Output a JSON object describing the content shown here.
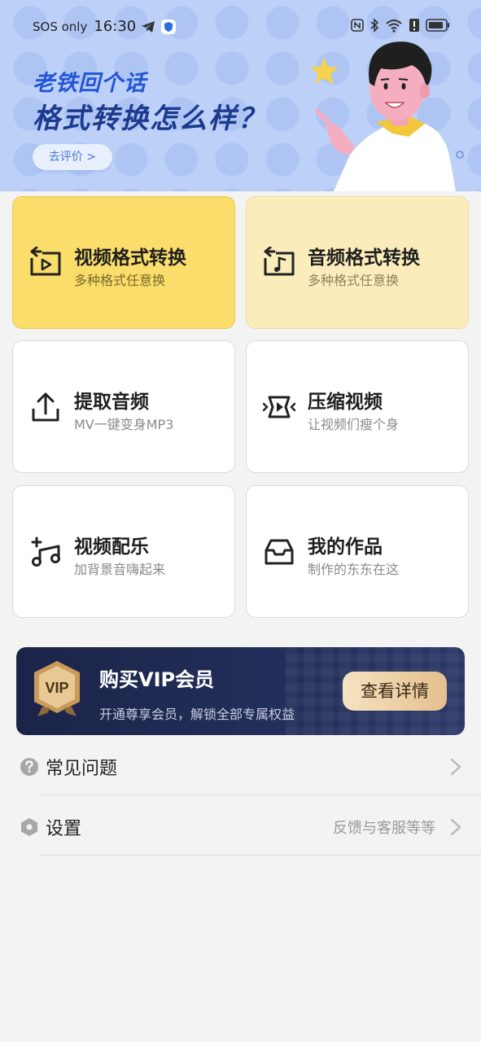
{
  "status_bar": {
    "carrier": "SOS only",
    "time": "16:30"
  },
  "banner": {
    "line1": "老铁回个话",
    "line2": "格式转换怎么样？",
    "rate_button": "去评价 >"
  },
  "features": [
    {
      "title": "视频格式转换",
      "subtitle": "多种格式任意换",
      "icon": "video-convert-icon"
    },
    {
      "title": "音频格式转换",
      "subtitle": "多种格式任意换",
      "icon": "audio-convert-icon"
    },
    {
      "title": "提取音频",
      "subtitle": "MV一键变身MP3",
      "icon": "upload-icon"
    },
    {
      "title": "压缩视频",
      "subtitle": "让视频们瘦个身",
      "icon": "compress-video-icon"
    },
    {
      "title": "视频配乐",
      "subtitle": "加背景音嗨起来",
      "icon": "add-music-icon"
    },
    {
      "title": "我的作品",
      "subtitle": "制作的东东在这",
      "icon": "inbox-icon"
    }
  ],
  "vip": {
    "badge_text": "VIP",
    "title": "购买VIP会员",
    "subtitle": "开通尊享会员，解锁全部专属权益",
    "button": "查看详情"
  },
  "list": {
    "faq_label": "常见问题",
    "settings_label": "设置",
    "settings_hint": "反馈与客服等等"
  },
  "colors": {
    "banner_bg": "#bcd0f8",
    "highlight_yellow": "#fadd6a",
    "highlight_light": "#fbedbb",
    "vip_bg": "#1b2448",
    "vip_button": "#e4c08e"
  }
}
